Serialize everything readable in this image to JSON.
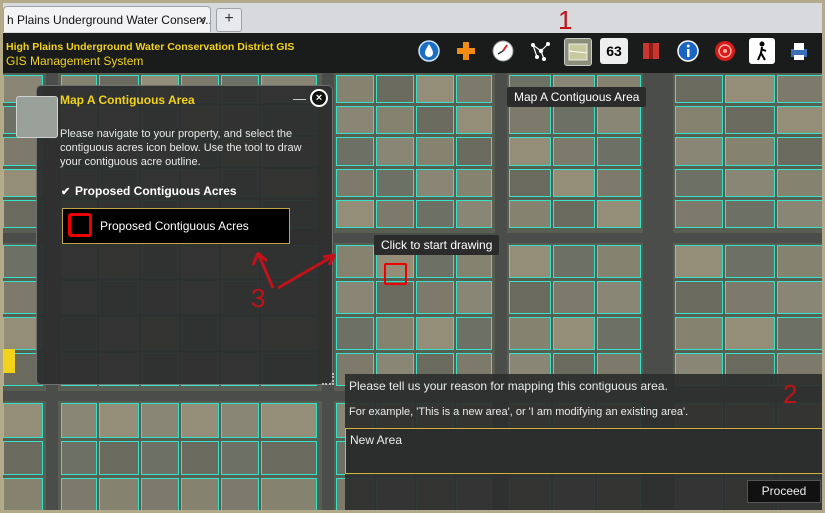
{
  "browser": {
    "tab_title": "h Plains Underground Water Conserv...",
    "tab_close": "×",
    "new_tab": "+"
  },
  "header": {
    "title_line1": "High Plains Underground Water Conservation District GIS",
    "title_line2": "GIS Management System"
  },
  "toolbar": {
    "icons": [
      "water-drop-icon",
      "plus-icon",
      "clock-icon",
      "network-icon",
      "map-contiguous-icon",
      "address-icon",
      "book-icon",
      "info-icon",
      "target-icon",
      "walking-person-icon",
      "print-icon"
    ],
    "address_text": "63"
  },
  "map": {
    "tooltip_top": "Map A Contiguous Area",
    "tooltip_draw": "Click to start drawing"
  },
  "panel": {
    "title": "Map A Contiguous Area",
    "minimize": "—",
    "close": "×",
    "instructions": "Please navigate to your property, and select the contiguous acres icon below.  Use the tool to draw your contiguous acre outline.",
    "checkbox_label": "Proposed Contiguous Acres",
    "checkbox_mark": "✔",
    "layer_label": "Proposed Contiguous Acres"
  },
  "reason": {
    "question": "Please tell us your reason for mapping this contiguous area.",
    "example": "For example, 'This is a new area', or 'I am modifying an existing area'.",
    "input_value": "New Area",
    "proceed_label": "Proceed"
  },
  "annotations": {
    "one": "1",
    "two": "2",
    "three": "3"
  },
  "colors": {
    "accent_yellow": "#f2d21a",
    "parcel_cyan": "#35e3c8",
    "annotation_red": "#c1121a"
  }
}
